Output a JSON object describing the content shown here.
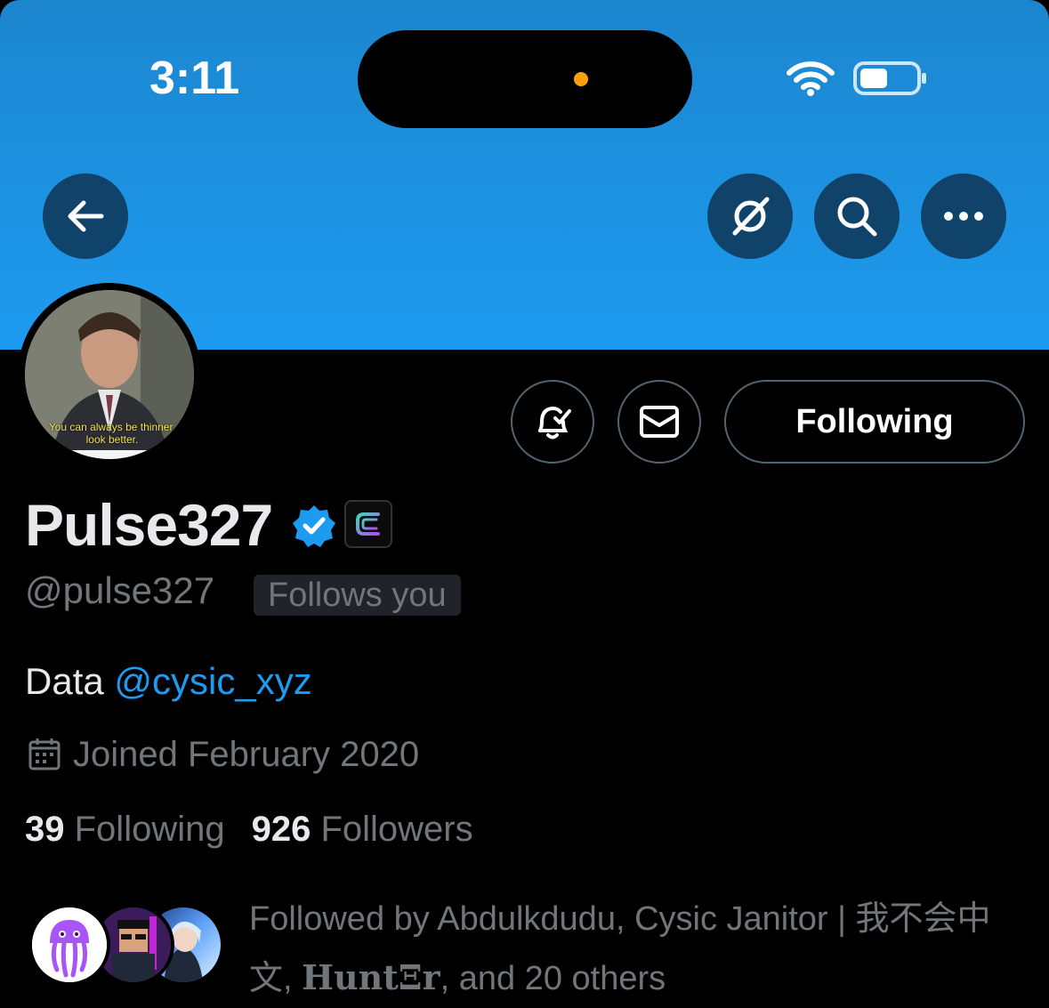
{
  "status_bar": {
    "time": "3:11"
  },
  "profile": {
    "display_name": "Pulse327",
    "handle": "@pulse327",
    "follows_you_label": "Follows you",
    "avatar_caption": "You can always be thinner, look better.",
    "bio_text": "Data ",
    "bio_mention": "@cysic_xyz",
    "joined": "Joined February 2020",
    "following_count": "39",
    "following_label": "Following",
    "followers_count": "926",
    "followers_label": "Followers",
    "followed_by_prefix": "Followed by Abdulkdudu, Cysic Janitor | 我不会中文, ",
    "followed_by_styled_name": "HuntΞr",
    "followed_by_suffix": ", and 20 others"
  },
  "actions": {
    "following_button": "Following"
  },
  "icons": {
    "back": "back-arrow-icon",
    "grok": "grok-icon",
    "search": "search-icon",
    "more": "more-icon",
    "notify": "bell-check-icon",
    "message": "envelope-icon",
    "verified": "verified-badge-icon",
    "affiliate": "cysic-logo-icon",
    "calendar": "calendar-icon"
  },
  "colors": {
    "banner": "#1d9bf0",
    "accent": "#1d9bf0",
    "background": "#000000",
    "text_primary": "#e7e9ea",
    "text_secondary": "#71767b"
  }
}
